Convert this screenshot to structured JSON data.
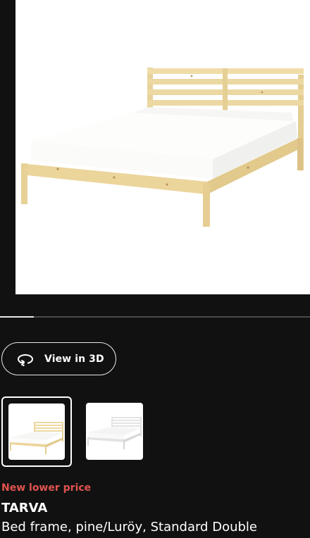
{
  "gallery": {
    "main_image_icon": "bed-frame-image",
    "progress": 0.11,
    "thumbnails": [
      {
        "icon": "pine-bed-thumbnail",
        "selected": true
      },
      {
        "icon": "white-bed-thumbnail",
        "selected": false
      }
    ]
  },
  "view3d": {
    "label": "View in 3D",
    "icon": "rotate-360-icon"
  },
  "product": {
    "promo": "New lower price",
    "name": "TARVA",
    "description": "Bed frame, pine/Luröy, Standard Double"
  },
  "colors": {
    "background": "#111111",
    "promo_red": "#e0544e",
    "pine": "#ecd9a3",
    "white": "#ffffff"
  }
}
